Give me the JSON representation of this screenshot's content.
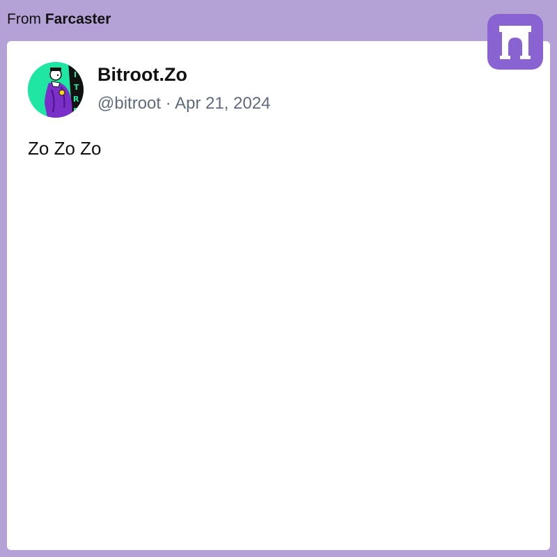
{
  "source": {
    "prefix": "From",
    "name": "Farcaster"
  },
  "post": {
    "display_name": "Bitroot.Zo",
    "handle": "@bitroot",
    "separator": "·",
    "date": "Apr 21, 2024",
    "text": "Zo Zo Zo",
    "avatar_icon": "avatar-image"
  },
  "app_badge": {
    "icon": "farcaster-arch-icon",
    "color": "#8a63d2"
  },
  "colors": {
    "background": "#b4a2d6",
    "card": "#ffffff",
    "text": "#111111",
    "meta": "#5f6b7a",
    "avatar_bg": "#20e6a4",
    "accent": "#8a63d2"
  }
}
